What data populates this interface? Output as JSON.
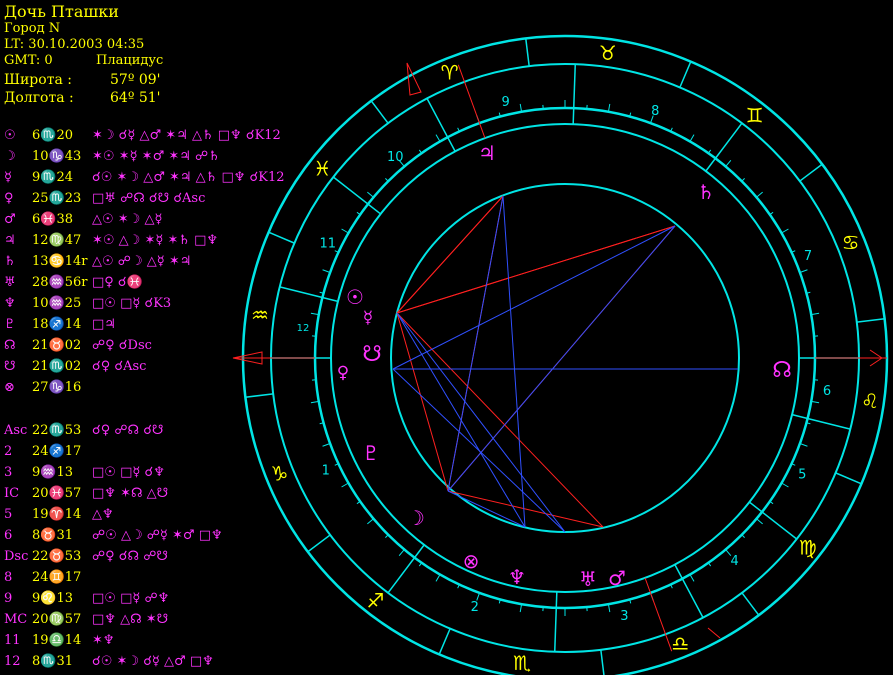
{
  "header": {
    "title": "Дочь Пташки",
    "city": "Город N",
    "lt": "LT: 30.10.2003  04:35",
    "gmt": "GMT: 0",
    "system": "Плацидус",
    "lat_label": "Широта :",
    "lat_value": "57º 09'",
    "lon_label": "Долгота :",
    "lon_value": "64º 51'"
  },
  "colors": {
    "ring": "#00e5e5",
    "text_yellow": "#ffff00",
    "glyph": "#ff33ff",
    "line_red": "#ff2020",
    "line_blue": "#3050ff",
    "house_num": "#00e5e5"
  },
  "planets": [
    {
      "sym": "☉",
      "pos": "6♏20",
      "asp": "✶☽ ☌☿ △♂ ✶♃ △♄ □♆ ☌K12"
    },
    {
      "sym": "☽",
      "pos": "10♑43",
      "asp": "✶☉ ✶☿ ✶♂ ✶♃ ☍♄"
    },
    {
      "sym": "☿",
      "pos": "9♏24",
      "asp": "☌☉ ✶☽ △♂ ✶♃ △♄ □♆ ☌K12"
    },
    {
      "sym": "♀",
      "pos": "25♏23",
      "asp": "□♅ ☍☊ ☌☋ ☌Asc"
    },
    {
      "sym": "♂",
      "pos": "6♓38",
      "asp": "△☉ ✶☽ △☿"
    },
    {
      "sym": "♃",
      "pos": "12♍47",
      "asp": "✶☉ △☽ ✶☿ ✶♄ □♆"
    },
    {
      "sym": "♄",
      "pos": "13♋14r",
      "asp": "△☉ ☍☽ △☿ ✶♃"
    },
    {
      "sym": "♅",
      "pos": "28♒56r",
      "asp": "□♀ ☌♓"
    },
    {
      "sym": "♆",
      "pos": "10♒25",
      "asp": "□☉ □☿ ☌K3"
    },
    {
      "sym": "♇",
      "pos": "18♐14",
      "asp": "□♃"
    },
    {
      "sym": "☊",
      "pos": "21♉02",
      "asp": "☍♀ ☌Dsc"
    },
    {
      "sym": "☋",
      "pos": "21♏02",
      "asp": "☌♀ ☌Asc"
    },
    {
      "sym": "⊗",
      "pos": "27♑16",
      "asp": ""
    }
  ],
  "houses": [
    {
      "sym": "Asc",
      "pos": "22♏53",
      "asp": "☌♀ ☍☊ ☌☋"
    },
    {
      "sym": "2",
      "pos": "24♐17",
      "asp": ""
    },
    {
      "sym": "3",
      "pos": "9♒13",
      "asp": "□☉ □☿ ☌♆"
    },
    {
      "sym": "IC",
      "pos": "20♓57",
      "asp": "□♆ ✶☊ △☋"
    },
    {
      "sym": "5",
      "pos": "19♈14",
      "asp": "△♆"
    },
    {
      "sym": "6",
      "pos": "8♉31",
      "asp": "☍☉ △☽ ☍☿ ✶♂ □♆"
    },
    {
      "sym": "Dsc",
      "pos": "22♉53",
      "asp": "☍♀ ☌☊ ☍☋"
    },
    {
      "sym": "8",
      "pos": "24♊17",
      "asp": ""
    },
    {
      "sym": "9",
      "pos": "9♌13",
      "asp": "□☉ □☿ ☍♆"
    },
    {
      "sym": "MC",
      "pos": "20♍57",
      "asp": "□♆ △☊ ✶☋"
    },
    {
      "sym": "11",
      "pos": "19♎14",
      "asp": "✶♆"
    },
    {
      "sym": "12",
      "pos": "8♏31",
      "asp": "☌☉ ✶☽ ☌☿ △♂ □♆"
    }
  ],
  "wheel": {
    "zodiac_glyphs": [
      "♋",
      "♊",
      "♉",
      "♈",
      "♓",
      "♒",
      "♑",
      "♐",
      "♏",
      "♎",
      "♍",
      "♌"
    ],
    "house_numbers": [
      "1",
      "2",
      "3",
      "4",
      "5",
      "6",
      "7",
      "8",
      "9",
      "10",
      "11",
      "12"
    ],
    "chart_planets": [
      {
        "name": "sun",
        "glyph": "☉"
      },
      {
        "name": "mercury",
        "glyph": "☿"
      },
      {
        "name": "node-south",
        "glyph": "☋"
      },
      {
        "name": "venus",
        "glyph": "♀"
      },
      {
        "name": "pluto",
        "glyph": "♇"
      },
      {
        "name": "moon",
        "glyph": "☽"
      },
      {
        "name": "fortune",
        "glyph": "⊗"
      },
      {
        "name": "neptune",
        "glyph": "♆"
      },
      {
        "name": "uranus",
        "glyph": "♅"
      },
      {
        "name": "mars",
        "glyph": "♂"
      },
      {
        "name": "jupiter",
        "glyph": "♃"
      },
      {
        "name": "saturn",
        "glyph": "♄"
      },
      {
        "name": "node-north",
        "glyph": "☊"
      }
    ]
  }
}
